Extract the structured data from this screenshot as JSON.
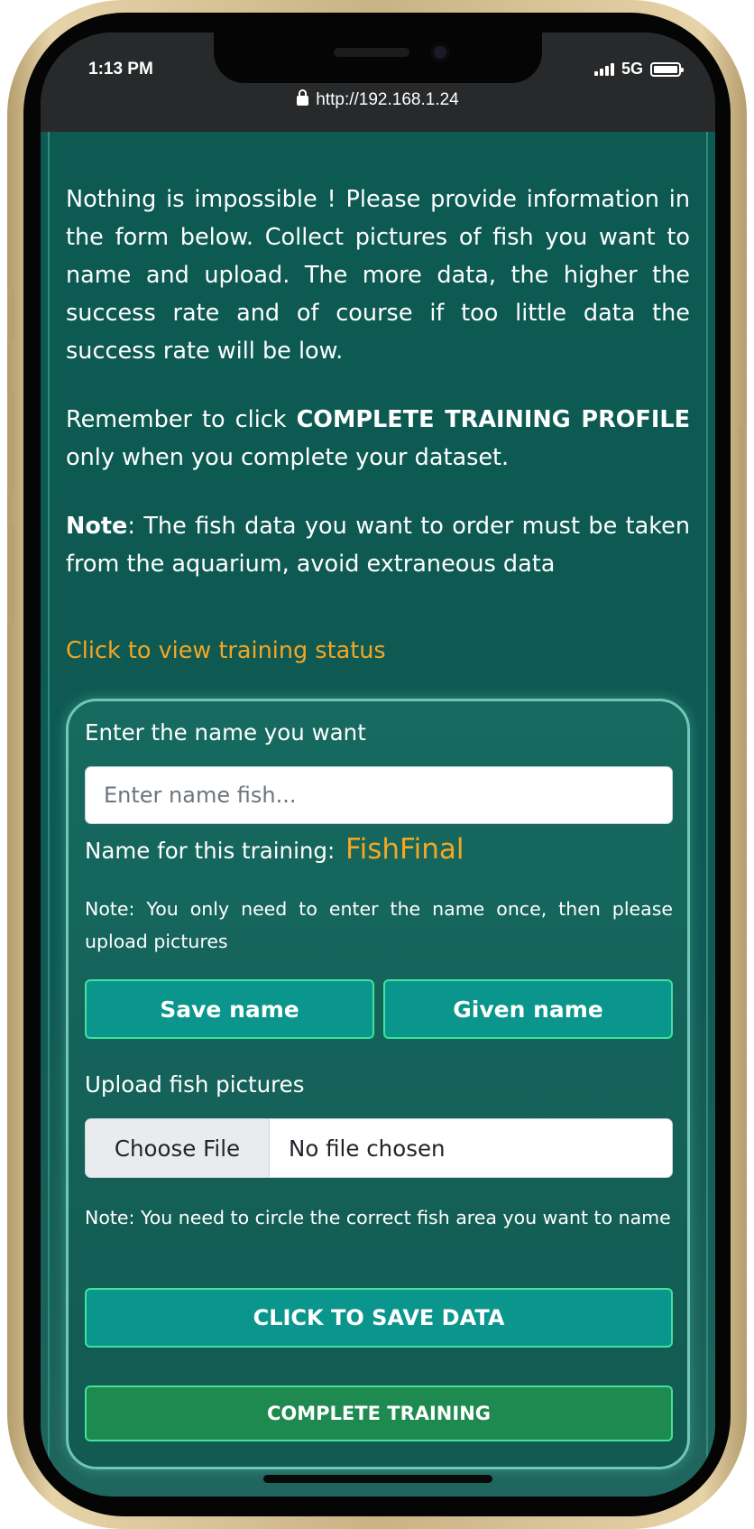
{
  "status_bar": {
    "time": "1:13 PM",
    "network": "5G",
    "url": "http://192.168.1.24",
    "icons": [
      "signal-icon",
      "battery-icon",
      "lock-icon"
    ]
  },
  "intro": {
    "paragraph1": "Nothing is impossible ! Please provide information in the form below. Collect pictures of fish you want to name and upload. The more data, the higher the success rate and of course if too little data the success rate will be low.",
    "paragraph2_prefix": "Remember to click ",
    "paragraph2_bold": "COMPLETE TRAINING PROFILE",
    "paragraph2_suffix": " only when you complete your dataset.",
    "paragraph3_bold": "Note",
    "paragraph3_rest": ": The fish data you want to order must be taken from the aquarium, avoid extraneous data"
  },
  "status_link": "Click to view training status",
  "form": {
    "name_label": "Enter the name you want",
    "name_placeholder": "Enter name fish...",
    "name_value": "",
    "training_name_label": "Name for this training:",
    "training_name_value": "FishFinal",
    "note_name": "Note: You only need to enter the name once, then please upload pictures",
    "save_name_button": "Save name",
    "given_name_button": "Given name",
    "upload_label": "Upload fish pictures",
    "file_choose_label": "Choose File",
    "file_status": "No file chosen",
    "note_upload": "Note: You need to circle the correct fish area you want to name",
    "save_data_button": "CLICK TO SAVE DATA",
    "complete_button": "COMPLETE TRAINING"
  },
  "colors": {
    "page_bg": "#0e5a52",
    "accent_orange": "#f5a623",
    "button_teal": "#0a968c",
    "button_green": "#1f8a4f",
    "button_border": "#3fe39b"
  }
}
